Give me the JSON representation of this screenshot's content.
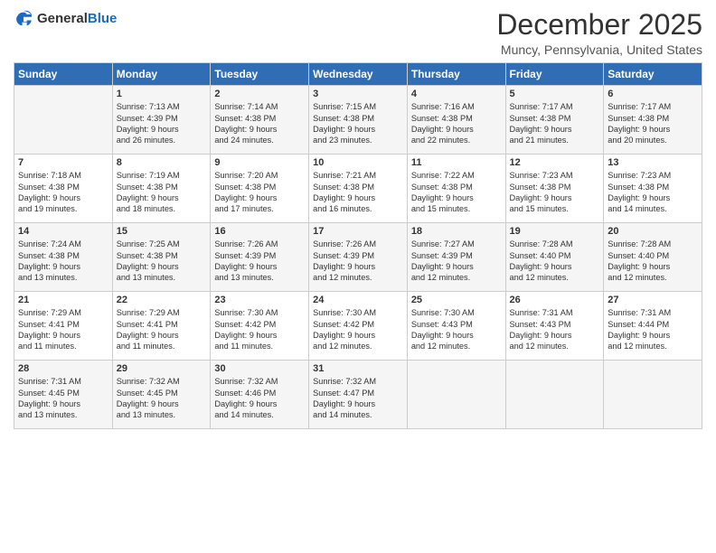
{
  "header": {
    "logo_general": "General",
    "logo_blue": "Blue",
    "title": "December 2025",
    "location": "Muncy, Pennsylvania, United States"
  },
  "days_of_week": [
    "Sunday",
    "Monday",
    "Tuesday",
    "Wednesday",
    "Thursday",
    "Friday",
    "Saturday"
  ],
  "weeks": [
    [
      {
        "day": "",
        "content": ""
      },
      {
        "day": "1",
        "content": "Sunrise: 7:13 AM\nSunset: 4:39 PM\nDaylight: 9 hours\nand 26 minutes."
      },
      {
        "day": "2",
        "content": "Sunrise: 7:14 AM\nSunset: 4:38 PM\nDaylight: 9 hours\nand 24 minutes."
      },
      {
        "day": "3",
        "content": "Sunrise: 7:15 AM\nSunset: 4:38 PM\nDaylight: 9 hours\nand 23 minutes."
      },
      {
        "day": "4",
        "content": "Sunrise: 7:16 AM\nSunset: 4:38 PM\nDaylight: 9 hours\nand 22 minutes."
      },
      {
        "day": "5",
        "content": "Sunrise: 7:17 AM\nSunset: 4:38 PM\nDaylight: 9 hours\nand 21 minutes."
      },
      {
        "day": "6",
        "content": "Sunrise: 7:17 AM\nSunset: 4:38 PM\nDaylight: 9 hours\nand 20 minutes."
      }
    ],
    [
      {
        "day": "7",
        "content": "Sunrise: 7:18 AM\nSunset: 4:38 PM\nDaylight: 9 hours\nand 19 minutes."
      },
      {
        "day": "8",
        "content": "Sunrise: 7:19 AM\nSunset: 4:38 PM\nDaylight: 9 hours\nand 18 minutes."
      },
      {
        "day": "9",
        "content": "Sunrise: 7:20 AM\nSunset: 4:38 PM\nDaylight: 9 hours\nand 17 minutes."
      },
      {
        "day": "10",
        "content": "Sunrise: 7:21 AM\nSunset: 4:38 PM\nDaylight: 9 hours\nand 16 minutes."
      },
      {
        "day": "11",
        "content": "Sunrise: 7:22 AM\nSunset: 4:38 PM\nDaylight: 9 hours\nand 15 minutes."
      },
      {
        "day": "12",
        "content": "Sunrise: 7:23 AM\nSunset: 4:38 PM\nDaylight: 9 hours\nand 15 minutes."
      },
      {
        "day": "13",
        "content": "Sunrise: 7:23 AM\nSunset: 4:38 PM\nDaylight: 9 hours\nand 14 minutes."
      }
    ],
    [
      {
        "day": "14",
        "content": "Sunrise: 7:24 AM\nSunset: 4:38 PM\nDaylight: 9 hours\nand 13 minutes."
      },
      {
        "day": "15",
        "content": "Sunrise: 7:25 AM\nSunset: 4:38 PM\nDaylight: 9 hours\nand 13 minutes."
      },
      {
        "day": "16",
        "content": "Sunrise: 7:26 AM\nSunset: 4:39 PM\nDaylight: 9 hours\nand 13 minutes."
      },
      {
        "day": "17",
        "content": "Sunrise: 7:26 AM\nSunset: 4:39 PM\nDaylight: 9 hours\nand 12 minutes."
      },
      {
        "day": "18",
        "content": "Sunrise: 7:27 AM\nSunset: 4:39 PM\nDaylight: 9 hours\nand 12 minutes."
      },
      {
        "day": "19",
        "content": "Sunrise: 7:28 AM\nSunset: 4:40 PM\nDaylight: 9 hours\nand 12 minutes."
      },
      {
        "day": "20",
        "content": "Sunrise: 7:28 AM\nSunset: 4:40 PM\nDaylight: 9 hours\nand 12 minutes."
      }
    ],
    [
      {
        "day": "21",
        "content": "Sunrise: 7:29 AM\nSunset: 4:41 PM\nDaylight: 9 hours\nand 11 minutes."
      },
      {
        "day": "22",
        "content": "Sunrise: 7:29 AM\nSunset: 4:41 PM\nDaylight: 9 hours\nand 11 minutes."
      },
      {
        "day": "23",
        "content": "Sunrise: 7:30 AM\nSunset: 4:42 PM\nDaylight: 9 hours\nand 11 minutes."
      },
      {
        "day": "24",
        "content": "Sunrise: 7:30 AM\nSunset: 4:42 PM\nDaylight: 9 hours\nand 12 minutes."
      },
      {
        "day": "25",
        "content": "Sunrise: 7:30 AM\nSunset: 4:43 PM\nDaylight: 9 hours\nand 12 minutes."
      },
      {
        "day": "26",
        "content": "Sunrise: 7:31 AM\nSunset: 4:43 PM\nDaylight: 9 hours\nand 12 minutes."
      },
      {
        "day": "27",
        "content": "Sunrise: 7:31 AM\nSunset: 4:44 PM\nDaylight: 9 hours\nand 12 minutes."
      }
    ],
    [
      {
        "day": "28",
        "content": "Sunrise: 7:31 AM\nSunset: 4:45 PM\nDaylight: 9 hours\nand 13 minutes."
      },
      {
        "day": "29",
        "content": "Sunrise: 7:32 AM\nSunset: 4:45 PM\nDaylight: 9 hours\nand 13 minutes."
      },
      {
        "day": "30",
        "content": "Sunrise: 7:32 AM\nSunset: 4:46 PM\nDaylight: 9 hours\nand 14 minutes."
      },
      {
        "day": "31",
        "content": "Sunrise: 7:32 AM\nSunset: 4:47 PM\nDaylight: 9 hours\nand 14 minutes."
      },
      {
        "day": "",
        "content": ""
      },
      {
        "day": "",
        "content": ""
      },
      {
        "day": "",
        "content": ""
      }
    ]
  ]
}
